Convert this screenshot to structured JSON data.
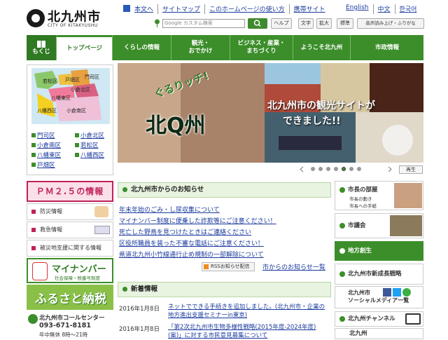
{
  "header": {
    "title": "北九州市",
    "subtitle": "CITY OF KITAKYUSHU",
    "links": [
      "本文へ",
      "サイトマップ",
      "このホームページの使い方",
      "携帯サイト",
      "English",
      "中文",
      "한국어"
    ],
    "search_placeholder": "カスタム検索",
    "search_prefix": "Google",
    "help": "ヘルプ",
    "text": "文字",
    "zoom": "拡大",
    "standard": "標準",
    "voice": "音声読み上げ・ふりがな"
  },
  "nav": {
    "home": "もくじ",
    "items": [
      "トップページ",
      "くらしの情報",
      "観光・\nおでかけ",
      "ビジネス・産業・\nまちづくり",
      "ようこそ北九州",
      "市政情報"
    ]
  },
  "map": {
    "wards": [
      "若松区",
      "戸畑区",
      "門司区",
      "小倉北区",
      "八幡東区",
      "八幡西区",
      "小倉南区"
    ],
    "links": [
      "門司区",
      "小倉北区",
      "小倉南区",
      "若松区",
      "八幡東区",
      "八幡西区",
      "戸畑区"
    ]
  },
  "left_banners": {
    "pm25": "ＰＭ２.５の情報",
    "disaster": "防災情報",
    "emergency": "救急情報",
    "evac": "被災地支援に関する情報",
    "mynumber": "マイナンバー",
    "mynumber_sub": "社会保障・税番号制度",
    "furusato": "ふるさと納税",
    "callcenter": "北九州市コールセンター",
    "tel": "093-671-8181",
    "hours": "年中無休 8時～21時"
  },
  "slide": {
    "caption1": "北九州市の観光サイトが",
    "caption2": "できました!!",
    "logo1": "ぐるりッチ!",
    "logo2": "北Q州",
    "play": "再生"
  },
  "notice": {
    "title": "北九州市からのお知らせ",
    "items": [
      "年末年始のごみ・し尿収集について",
      "マイナンバー制度に便乗した詐欺等にご注意ください！",
      "死亡した野鳥を見つけたときはご連絡ください",
      "区役所職員を装った不審な電話にご注意ください！",
      "県道北九州小竹線通行止め規制の一部解除について"
    ],
    "rss": "RSSお知らせ配信",
    "more": "市からのお知らせ一覧"
  },
  "news": {
    "title": "新着情報",
    "items": [
      {
        "date": "2016年1月8日",
        "text": "ネットでできる手続きを追加しました。(北九州市・企業の",
        "text2": "地方進出支援セミナーin東京)"
      },
      {
        "date": "2016年1月8日",
        "text": "「第2次北九州市生物多様性戦略(2015年度-2024年度)",
        "text2": "(案)」に対する市民意見募集について"
      }
    ]
  },
  "right": {
    "mayor": "市長の部屋",
    "mayor_sub1": "市長の動き",
    "mayor_sub2": "市長への手紙",
    "council": "市議会",
    "chiho": "地方創生",
    "strategy": "北九州市新成長戦略",
    "social1": "北九州市",
    "social2": "ソーシャルメディア一覧",
    "channel": "北九州チャンネル",
    "city": "北九州"
  },
  "colors": {
    "green": "#3c8e2a",
    "link": "#1a3a9e",
    "pm25": "#c0215a"
  }
}
